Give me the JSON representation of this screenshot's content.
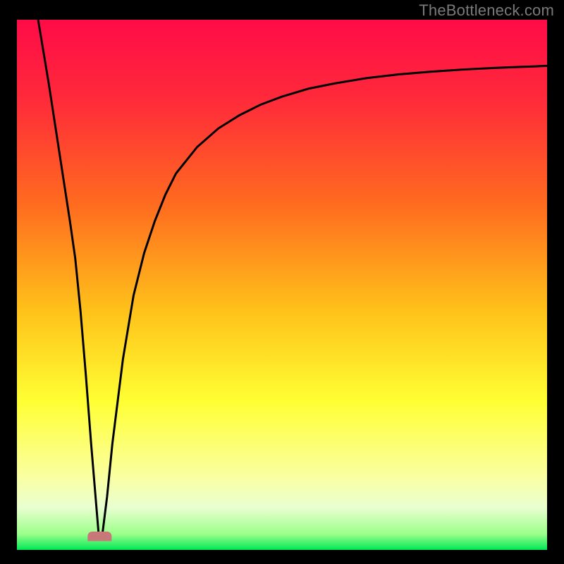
{
  "watermark": "TheBottleneck.com",
  "colors": {
    "frame": "#000000",
    "watermark_text": "#7a7a7a",
    "curve_stroke": "#000000",
    "marker_fill": "#c87878",
    "gradient_stops": [
      {
        "offset": 0.0,
        "color": "#ff0b48"
      },
      {
        "offset": 0.15,
        "color": "#ff2a3a"
      },
      {
        "offset": 0.35,
        "color": "#ff6c1f"
      },
      {
        "offset": 0.55,
        "color": "#ffc21a"
      },
      {
        "offset": 0.72,
        "color": "#ffff33"
      },
      {
        "offset": 0.86,
        "color": "#faffa0"
      },
      {
        "offset": 0.92,
        "color": "#e9ffd0"
      },
      {
        "offset": 0.97,
        "color": "#9bff8a"
      },
      {
        "offset": 1.0,
        "color": "#00e756"
      }
    ]
  },
  "chart_data": {
    "type": "line",
    "title": "",
    "xlabel": "",
    "ylabel": "",
    "xlim": [
      0,
      100
    ],
    "ylim": [
      0,
      100
    ],
    "grid": false,
    "legend": false,
    "annotations": [],
    "series": [
      {
        "name": "curve",
        "x": [
          4,
          6,
          8,
          10,
          11,
          12,
          13,
          14,
          15,
          15.5,
          16,
          17,
          18,
          20,
          22,
          24,
          26,
          28,
          30,
          34,
          38,
          42,
          46,
          50,
          55,
          60,
          66,
          72,
          78,
          84,
          90,
          95,
          100
        ],
        "y": [
          100,
          88,
          75,
          62,
          55,
          45,
          33,
          20,
          8,
          2,
          2,
          10,
          20,
          36,
          48,
          56,
          62,
          67,
          71,
          76,
          79.5,
          82,
          84,
          85.5,
          87,
          88,
          89,
          89.7,
          90.2,
          90.6,
          90.9,
          91.1,
          91.3
        ]
      }
    ],
    "markers": [
      {
        "name": "min-marker",
        "x_range": [
          14.2,
          17.0
        ],
        "y": 2
      }
    ]
  }
}
